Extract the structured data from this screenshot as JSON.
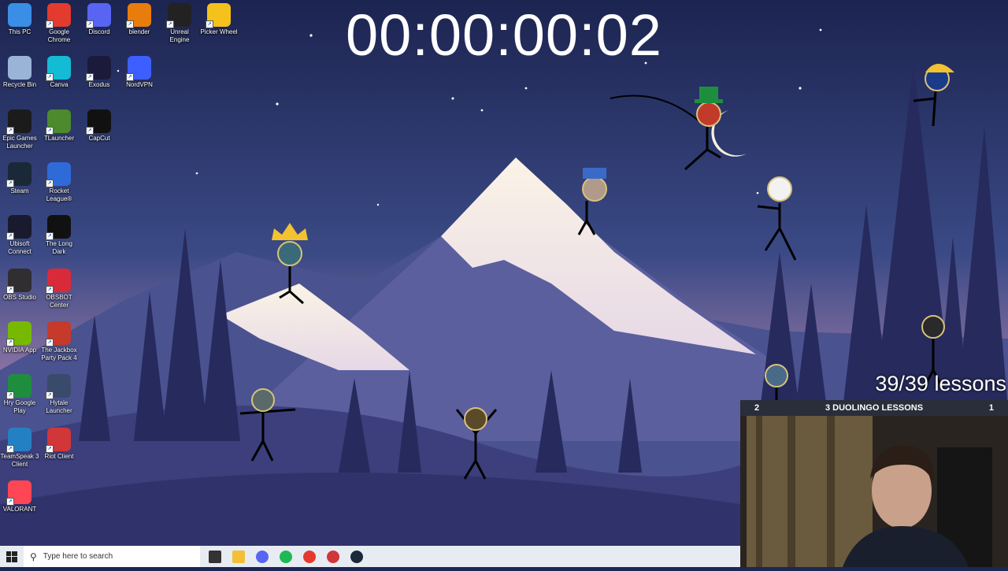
{
  "timer": "00:00:00:02",
  "overlay": {
    "lessons": "39/39 lessons",
    "webcam": {
      "title": "3 DUOLINGO LESSONS",
      "left_count": "2",
      "right_count": "1"
    }
  },
  "desktop_icons": [
    {
      "label": "This PC",
      "icon": "pc-icon",
      "color": "#3a8ee6"
    },
    {
      "label": "Google Chrome",
      "icon": "chrome-icon",
      "color": "#e33b2e"
    },
    {
      "label": "Discord",
      "icon": "discord-icon",
      "color": "#5865f2"
    },
    {
      "label": "blender",
      "icon": "blender-icon",
      "color": "#e87d0d"
    },
    {
      "label": "Unreal Engine",
      "icon": "unreal-icon",
      "color": "#222222"
    },
    {
      "label": "Picker Wheel",
      "icon": "picker-wheel-icon",
      "color": "#f4c21a"
    },
    {
      "label": "Recycle Bin",
      "icon": "recycle-bin-icon",
      "color": "#9ab4d8"
    },
    {
      "label": "Canva",
      "icon": "canva-icon",
      "color": "#13bcd4"
    },
    {
      "label": "Exodus",
      "icon": "exodus-icon",
      "color": "#1c1a3a"
    },
    {
      "label": "NordVPN",
      "icon": "nordvpn-icon",
      "color": "#3e5fff"
    },
    {
      "label": "Epic Games Launcher",
      "icon": "epic-games-icon",
      "color": "#1b1b1b"
    },
    {
      "label": "TLauncher",
      "icon": "tlauncher-icon",
      "color": "#4d8a2e"
    },
    {
      "label": "CapCut",
      "icon": "capcut-icon",
      "color": "#111111"
    },
    {
      "label": "Steam",
      "icon": "steam-icon",
      "color": "#1b2838"
    },
    {
      "label": "Rocket League®",
      "icon": "rocket-league-icon",
      "color": "#2f6bd8"
    },
    {
      "label": "Ubisoft Connect",
      "icon": "ubisoft-icon",
      "color": "#1a1a2e"
    },
    {
      "label": "The Long Dark",
      "icon": "long-dark-icon",
      "color": "#111111"
    },
    {
      "label": "OBS Studio",
      "icon": "obs-icon",
      "color": "#302e31"
    },
    {
      "label": "OBSBOT Center",
      "icon": "obsbot-icon",
      "color": "#d92a3a"
    },
    {
      "label": "NVIDIA App",
      "icon": "nvidia-icon",
      "color": "#76b900"
    },
    {
      "label": "The Jackbox Party Pack 4",
      "icon": "jackbox-icon",
      "color": "#c53a2a"
    },
    {
      "label": "Hry Google Play",
      "icon": "google-play-games-icon",
      "color": "#1e8e3e"
    },
    {
      "label": "Hytale Launcher",
      "icon": "hytale-icon",
      "color": "#3a4a6a"
    },
    {
      "label": "TeamSpeak 3 Client",
      "icon": "teamspeak-icon",
      "color": "#2580c3"
    },
    {
      "label": "Riot Client",
      "icon": "riot-icon",
      "color": "#d13639"
    },
    {
      "label": "VALORANT",
      "icon": "valorant-icon",
      "color": "#ff4655"
    }
  ],
  "taskbar": {
    "search_placeholder": "Type here to search",
    "apps": [
      {
        "icon": "task-view-icon",
        "color": "#333333"
      },
      {
        "icon": "file-explorer-icon",
        "color": "#f2c037"
      },
      {
        "icon": "discord-icon",
        "color": "#5865f2"
      },
      {
        "icon": "spotify-icon",
        "color": "#1db954"
      },
      {
        "icon": "chrome-icon",
        "color": "#e33b2e"
      },
      {
        "icon": "game-app-icon",
        "color": "#d13639"
      },
      {
        "icon": "steam-icon",
        "color": "#1b2838"
      }
    ]
  }
}
